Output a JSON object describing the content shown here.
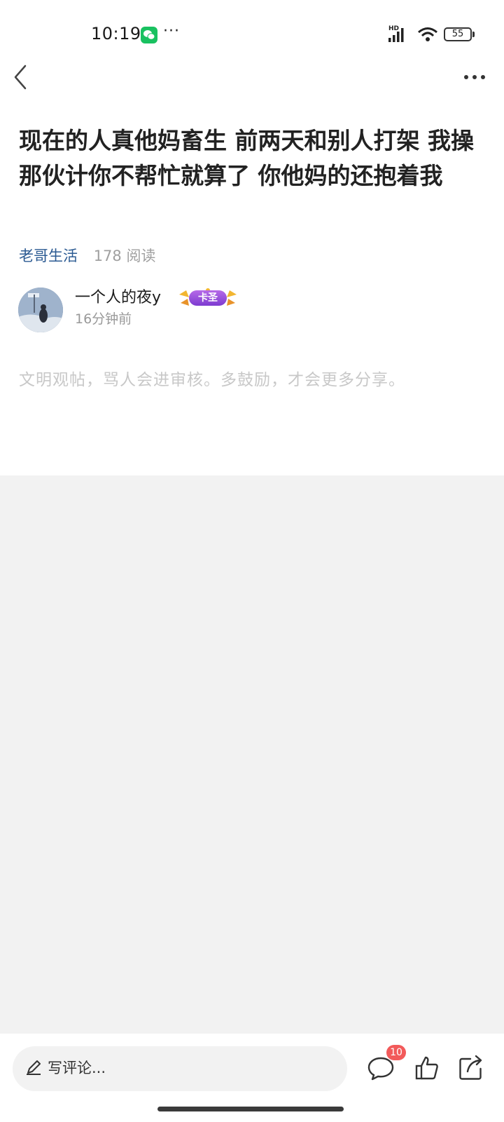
{
  "status_bar": {
    "time": "10:19",
    "more_dots": "···",
    "network_label": "HD",
    "battery_level": "55",
    "app_notification_icon": "wechat-icon"
  },
  "nav": {
    "back_icon": "chevron-left-icon",
    "more_icon": "more-horizontal-icon"
  },
  "post": {
    "title": "现在的人真他妈畜生 前两天和别人打架 我操 那伙计你不帮忙就算了 你他妈的还抱着我",
    "category": "老哥生活",
    "read_count": "178 阅读",
    "author": {
      "name": "一个人的夜y",
      "badge": "卡圣",
      "time": "16分钟前"
    },
    "comment_hint": "文明观帖，骂人会进审核。多鼓励，才会更多分享。"
  },
  "bottom_bar": {
    "comment_placeholder": "写评论...",
    "comment_count": "10",
    "icons": [
      "pencil-icon",
      "comment-icon",
      "thumbs-up-icon",
      "share-icon"
    ]
  },
  "colors": {
    "category": "#2b5a92",
    "badge": "#f25a5a",
    "background_gray": "#f2f2f2",
    "hint_text": "#c8c8c8"
  }
}
